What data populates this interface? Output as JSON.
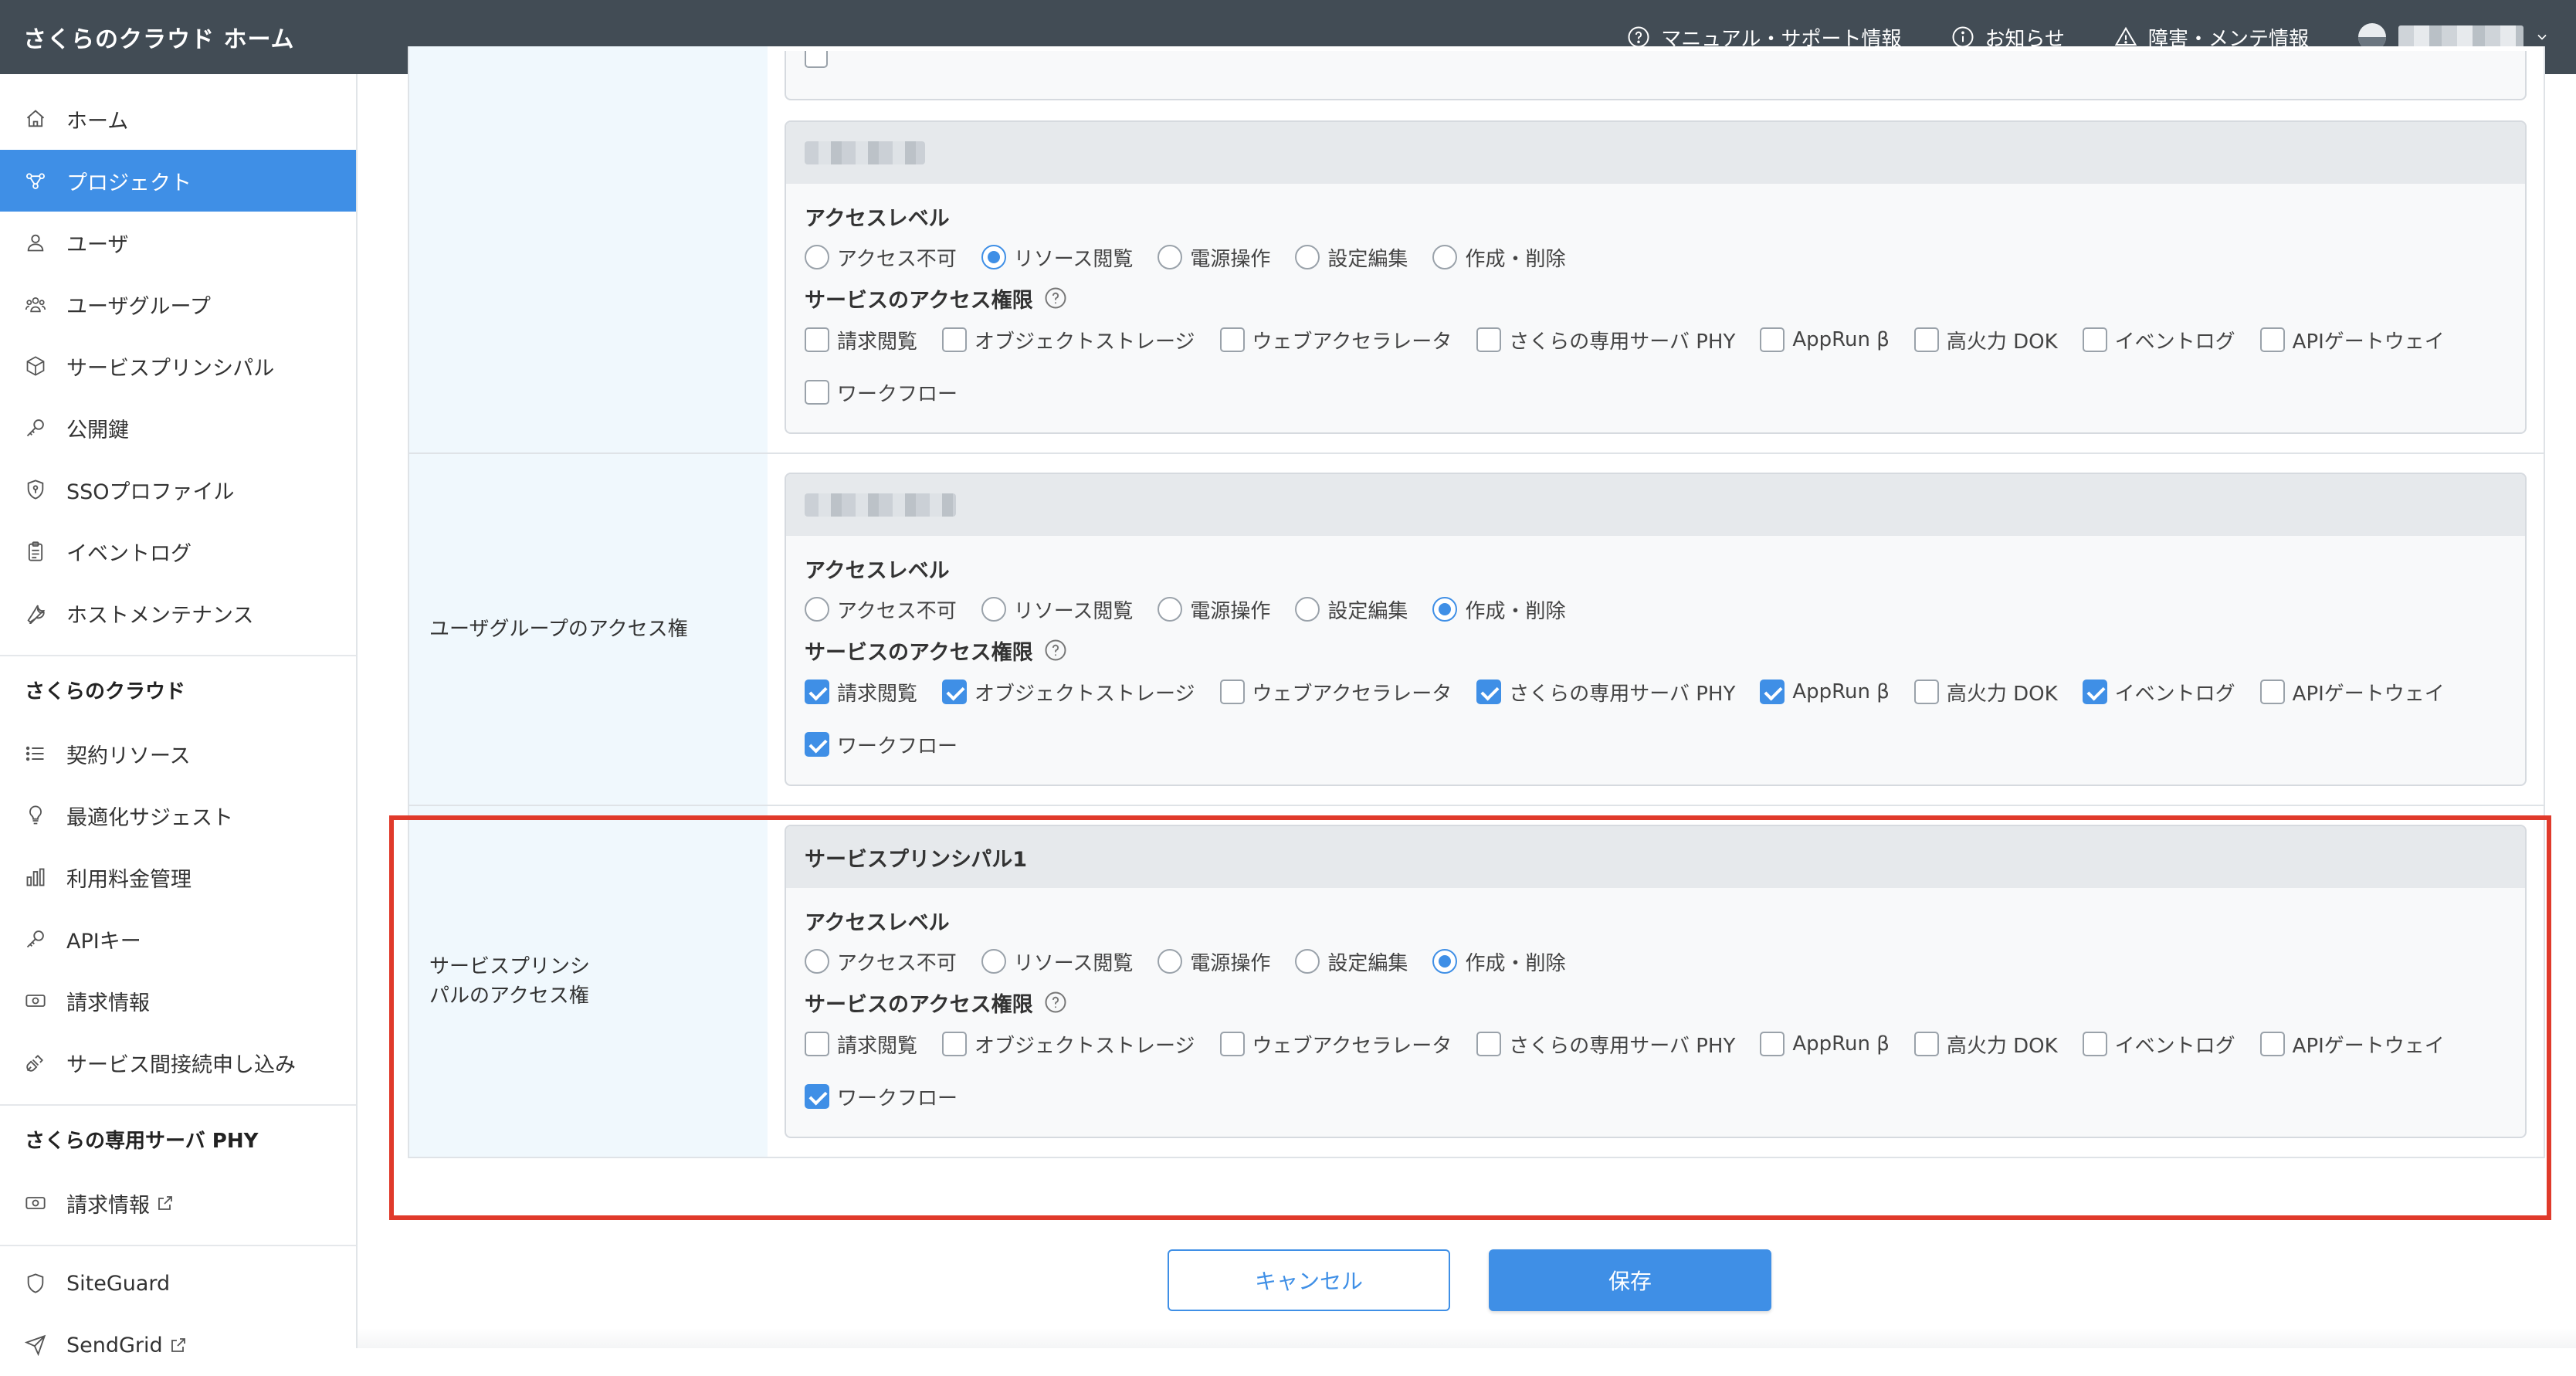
{
  "header": {
    "title": "さくらのクラウド ホーム",
    "links": [
      {
        "label": "マニュアル・サポート情報",
        "icon": "question-circle-icon"
      },
      {
        "label": "お知らせ",
        "icon": "info-circle-icon"
      },
      {
        "label": "障害・メンテ情報",
        "icon": "warning-triangle-icon"
      }
    ]
  },
  "sidebar": {
    "items": [
      {
        "label": "ホーム",
        "icon": "home-icon"
      },
      {
        "label": "プロジェクト",
        "icon": "project-icon",
        "active": true
      },
      {
        "label": "ユーザ",
        "icon": "user-icon"
      },
      {
        "label": "ユーザグループ",
        "icon": "user-group-icon"
      },
      {
        "label": "サービスプリンシパル",
        "icon": "cube-icon"
      },
      {
        "label": "公開鍵",
        "icon": "key-icon"
      },
      {
        "label": "SSOプロファイル",
        "icon": "shield-icon"
      },
      {
        "label": "イベントログ",
        "icon": "clipboard-icon"
      },
      {
        "label": "ホストメンテナンス",
        "icon": "wrench-icon"
      }
    ],
    "section_cloud": "さくらのクラウド",
    "cloud_items": [
      {
        "label": "契約リソース",
        "icon": "list-icon"
      },
      {
        "label": "最適化サジェスト",
        "icon": "lightbulb-icon"
      },
      {
        "label": "利用料金管理",
        "icon": "bar-chart-icon"
      },
      {
        "label": "APIキー",
        "icon": "key-icon"
      },
      {
        "label": "請求情報",
        "icon": "money-icon"
      },
      {
        "label": "サービス間接続申し込み",
        "icon": "plug-icon"
      }
    ],
    "section_phy": "さくらの専用サーバ PHY",
    "phy_items": [
      {
        "label": "請求情報",
        "icon": "money-icon",
        "external": true
      }
    ],
    "extra_items": [
      {
        "label": "SiteGuard",
        "icon": "shield-outline-icon"
      },
      {
        "label": "SendGrid",
        "icon": "send-icon",
        "external": true
      }
    ]
  },
  "form": {
    "access_level_label": "アクセスレベル",
    "service_access_label": "サービスのアクセス権限",
    "access_levels": [
      "アクセス不可",
      "リソース閲覧",
      "電源操作",
      "設定編集",
      "作成・削除"
    ],
    "services": [
      "請求閲覧",
      "オブジェクトストレージ",
      "ウェブアクセラレータ",
      "さくらの専用サーバ PHY",
      "AppRun β",
      "高火力 DOK",
      "イベントログ",
      "APIゲートウェイ",
      "ワークフロー"
    ],
    "user_card": {
      "selected_level": "リソース閲覧",
      "checked": [
        false,
        false,
        false,
        false,
        false,
        false,
        false,
        false,
        false
      ]
    },
    "group_row": {
      "label": "ユーザグループのアクセス権",
      "selected_level": "作成・削除",
      "checked": [
        true,
        true,
        false,
        true,
        true,
        false,
        true,
        false,
        true
      ]
    },
    "sp_row": {
      "label_line1": "サービスプリンシ",
      "label_line2": "パルのアクセス権",
      "card_title": "サービスプリンシパル1",
      "selected_level": "作成・削除",
      "checked": [
        false,
        false,
        false,
        false,
        false,
        false,
        false,
        false,
        true
      ]
    }
  },
  "actions": {
    "cancel": "キャンセル",
    "save": "保存"
  },
  "colors": {
    "topbar": "#424c55",
    "accent": "#3f8fe6",
    "label_bg": "#f0f8fd",
    "highlight": "#e03a2b"
  }
}
